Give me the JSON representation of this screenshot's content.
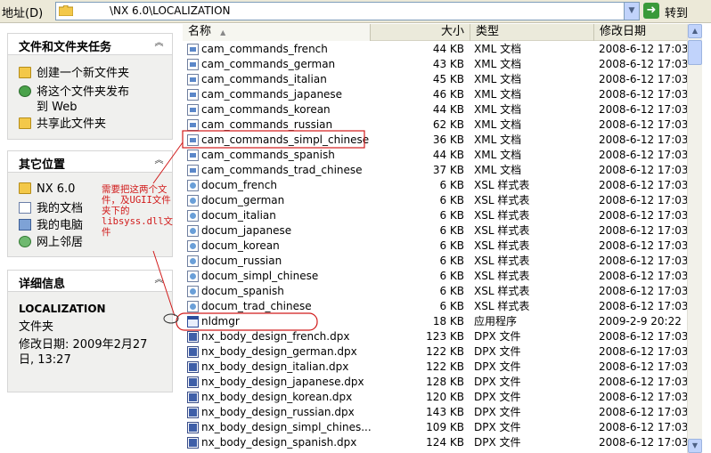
{
  "address_bar": {
    "label": "地址(D)",
    "path": "\\NX 6.0\\LOCALIZATION",
    "go_label": "转到"
  },
  "left_pane": {
    "tasks_panel": {
      "title": "文件和文件夹任务",
      "items": [
        {
          "label": "创建一个新文件夹",
          "icon": "new-folder-icon"
        },
        {
          "label": "将这个文件夹发布",
          "icon": "publish-web-icon"
        },
        {
          "label": "到 Web",
          "icon": ""
        },
        {
          "label": "共享此文件夹",
          "icon": "share-folder-icon"
        }
      ]
    },
    "places_panel": {
      "title": "其它位置",
      "items": [
        {
          "label": "NX 6.0",
          "icon": "folder-icon"
        },
        {
          "label": "我的文档",
          "icon": "my-documents-icon"
        },
        {
          "label": "我的电脑",
          "icon": "my-computer-icon"
        },
        {
          "label": "网上邻居",
          "icon": "network-places-icon"
        }
      ]
    },
    "details_panel": {
      "title": "详细信息",
      "name": "LOCALIZATION",
      "kind": "文件夹",
      "modified_line1": "修改日期: 2009年2月27",
      "modified_line2": "日, 13:27"
    }
  },
  "file_list": {
    "columns": {
      "name": "名称",
      "size": "大小",
      "type": "类型",
      "date": "修改日期"
    },
    "sort_arrow": "▲",
    "rows": [
      {
        "name": "cam_commands_french",
        "size": "44 KB",
        "type": "XML 文档",
        "date": "2008-6-12 17:03",
        "icon": "xml-file-icon"
      },
      {
        "name": "cam_commands_german",
        "size": "43 KB",
        "type": "XML 文档",
        "date": "2008-6-12 17:03",
        "icon": "xml-file-icon"
      },
      {
        "name": "cam_commands_italian",
        "size": "45 KB",
        "type": "XML 文档",
        "date": "2008-6-12 17:03",
        "icon": "xml-file-icon"
      },
      {
        "name": "cam_commands_japanese",
        "size": "46 KB",
        "type": "XML 文档",
        "date": "2008-6-12 17:03",
        "icon": "xml-file-icon"
      },
      {
        "name": "cam_commands_korean",
        "size": "44 KB",
        "type": "XML 文档",
        "date": "2008-6-12 17:03",
        "icon": "xml-file-icon"
      },
      {
        "name": "cam_commands_russian",
        "size": "62 KB",
        "type": "XML 文档",
        "date": "2008-6-12 17:03",
        "icon": "xml-file-icon"
      },
      {
        "name": "cam_commands_simpl_chinese",
        "size": "36 KB",
        "type": "XML 文档",
        "date": "2008-6-12 17:03",
        "icon": "xml-file-icon"
      },
      {
        "name": "cam_commands_spanish",
        "size": "44 KB",
        "type": "XML 文档",
        "date": "2008-6-12 17:03",
        "icon": "xml-file-icon"
      },
      {
        "name": "cam_commands_trad_chinese",
        "size": "37 KB",
        "type": "XML 文档",
        "date": "2008-6-12 17:03",
        "icon": "xml-file-icon"
      },
      {
        "name": "docum_french",
        "size": "6 KB",
        "type": "XSL 样式表",
        "date": "2008-6-12 17:03",
        "icon": "xsl-file-icon"
      },
      {
        "name": "docum_german",
        "size": "6 KB",
        "type": "XSL 样式表",
        "date": "2008-6-12 17:03",
        "icon": "xsl-file-icon"
      },
      {
        "name": "docum_italian",
        "size": "6 KB",
        "type": "XSL 样式表",
        "date": "2008-6-12 17:03",
        "icon": "xsl-file-icon"
      },
      {
        "name": "docum_japanese",
        "size": "6 KB",
        "type": "XSL 样式表",
        "date": "2008-6-12 17:03",
        "icon": "xsl-file-icon"
      },
      {
        "name": "docum_korean",
        "size": "6 KB",
        "type": "XSL 样式表",
        "date": "2008-6-12 17:03",
        "icon": "xsl-file-icon"
      },
      {
        "name": "docum_russian",
        "size": "6 KB",
        "type": "XSL 样式表",
        "date": "2008-6-12 17:03",
        "icon": "xsl-file-icon"
      },
      {
        "name": "docum_simpl_chinese",
        "size": "6 KB",
        "type": "XSL 样式表",
        "date": "2008-6-12 17:03",
        "icon": "xsl-file-icon"
      },
      {
        "name": "docum_spanish",
        "size": "6 KB",
        "type": "XSL 样式表",
        "date": "2008-6-12 17:03",
        "icon": "xsl-file-icon"
      },
      {
        "name": "docum_trad_chinese",
        "size": "6 KB",
        "type": "XSL 样式表",
        "date": "2008-6-12 17:03",
        "icon": "xsl-file-icon"
      },
      {
        "name": "nldmgr",
        "size": "18 KB",
        "type": "应用程序",
        "date": "2009-2-9 20:22",
        "icon": "application-icon"
      },
      {
        "name": "nx_body_design_french.dpx",
        "size": "123 KB",
        "type": "DPX 文件",
        "date": "2008-6-12 17:03",
        "icon": "dpx-file-icon"
      },
      {
        "name": "nx_body_design_german.dpx",
        "size": "122 KB",
        "type": "DPX 文件",
        "date": "2008-6-12 17:03",
        "icon": "dpx-file-icon"
      },
      {
        "name": "nx_body_design_italian.dpx",
        "size": "122 KB",
        "type": "DPX 文件",
        "date": "2008-6-12 17:03",
        "icon": "dpx-file-icon"
      },
      {
        "name": "nx_body_design_japanese.dpx",
        "size": "128 KB",
        "type": "DPX 文件",
        "date": "2008-6-12 17:03",
        "icon": "dpx-file-icon"
      },
      {
        "name": "nx_body_design_korean.dpx",
        "size": "120 KB",
        "type": "DPX 文件",
        "date": "2008-6-12 17:03",
        "icon": "dpx-file-icon"
      },
      {
        "name": "nx_body_design_russian.dpx",
        "size": "143 KB",
        "type": "DPX 文件",
        "date": "2008-6-12 17:03",
        "icon": "dpx-file-icon"
      },
      {
        "name": "nx_body_design_simpl_chines...",
        "size": "109 KB",
        "type": "DPX 文件",
        "date": "2008-6-12 17:03",
        "icon": "dpx-file-icon"
      },
      {
        "name": "nx_body_design_spanish.dpx",
        "size": "124 KB",
        "type": "DPX 文件",
        "date": "2008-6-12 17:03",
        "icon": "dpx-file-icon"
      }
    ]
  },
  "annotation": {
    "text": "需要把这两个文\n件，及UGII文件\n夹下的\nlibsyss.dll文\n件",
    "color": "#d11a1a"
  }
}
